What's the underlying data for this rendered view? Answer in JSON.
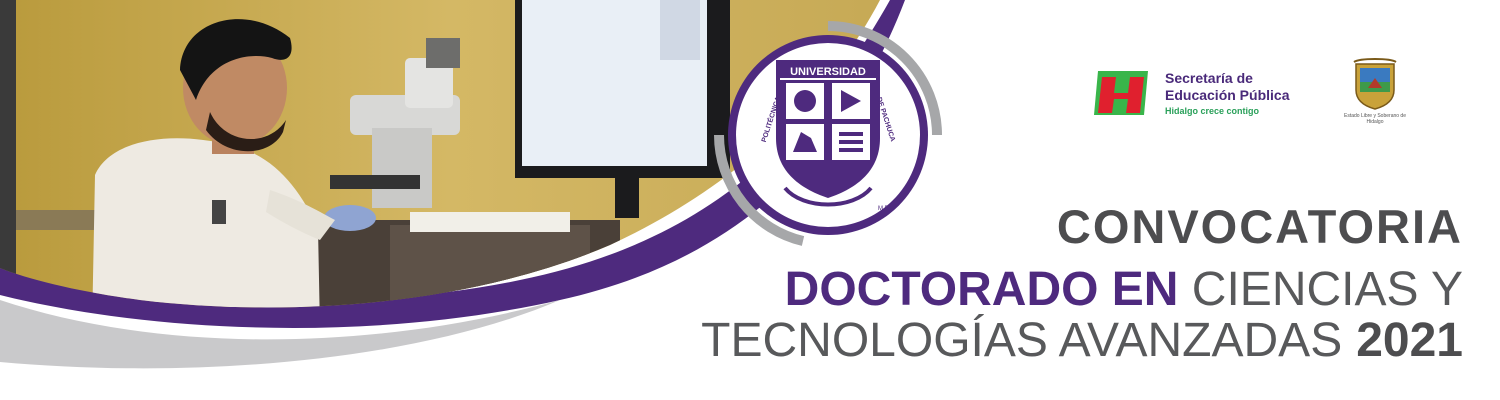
{
  "banner": {
    "title": "CONVOCATORIA",
    "program_bold": "DOCTORADO EN",
    "program_light_1": "CIENCIAS Y",
    "program_light_2": "TECNOLOGÍAS AVANZADAS",
    "year": "2021"
  },
  "university_seal": {
    "text_top": "UNIVERSIDAD",
    "text_left": "POLITÉCNICA",
    "text_right": "DE PACHUCA",
    "mark": "M.R."
  },
  "sep_logo": {
    "line1": "Secretaría de",
    "line2": "Educación Pública",
    "slogan": "Hidalgo crece contigo"
  },
  "state_logo": {
    "caption": "Estado Libre y Soberano de Hidalgo"
  },
  "colors": {
    "purple": "#4e2a7e",
    "gray_text": "#58595b",
    "gray_band": "#c8c8ca",
    "sep_red": "#e0202e",
    "sep_green": "#39b54a"
  }
}
